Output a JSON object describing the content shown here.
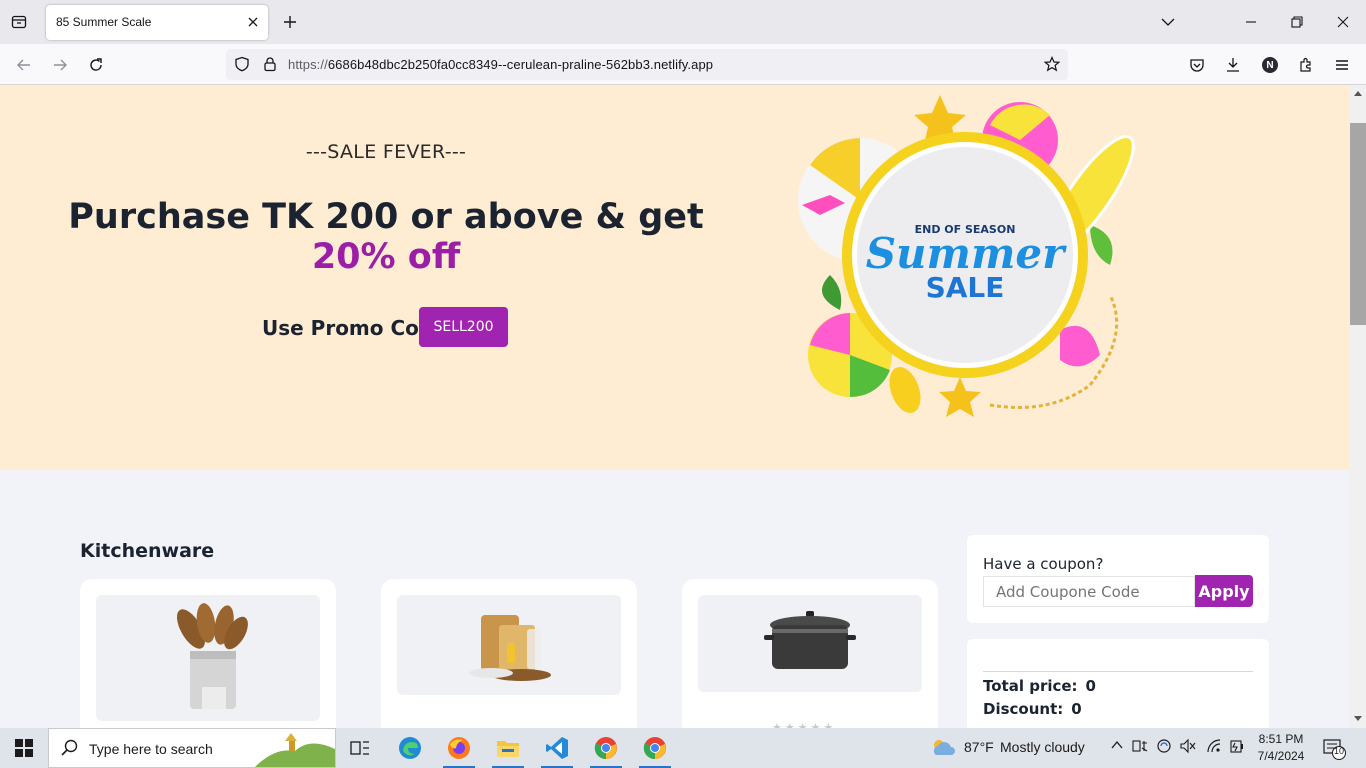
{
  "browser": {
    "tab_title": "85 Summer Scale",
    "url_prefix": "https://",
    "url_host": "6686b48dbc2b250fa0cc8349--cerulean-praline-562bb3.netlify.app",
    "profile_initial": "N"
  },
  "hero": {
    "kicker": "---SALE FEVER---",
    "title": "Purchase TK 200 or above & get",
    "discount": "20% off",
    "promo_label": "Use Promo Code",
    "promo_code": "SELL200",
    "banner": {
      "line1": "END OF SEASON",
      "line2": "Summer",
      "line3": "SALE"
    }
  },
  "kitchenware": {
    "title": "Kitchenware",
    "products": [
      {
        "icon": "utensil-holder-icon"
      },
      {
        "icon": "cutting-board-icon"
      },
      {
        "icon": "cooking-pot-icon"
      }
    ]
  },
  "coupon": {
    "label": "Have a coupon?",
    "placeholder": "Add Coupone Code",
    "apply_label": "Apply"
  },
  "summary": {
    "total_label": "Total price:",
    "total_value": "0",
    "discount_label": "Discount:",
    "discount_value": "0"
  },
  "taskbar": {
    "search_placeholder": "Type here to search",
    "weather_temp": "87°F",
    "weather_text": "Mostly cloudy",
    "time": "8:51 PM",
    "date": "7/4/2024",
    "notification_count": "10"
  },
  "colors": {
    "accent": "#a124b0",
    "hero_bg": "#feecd3",
    "page_bg": "#f2f3f8"
  }
}
